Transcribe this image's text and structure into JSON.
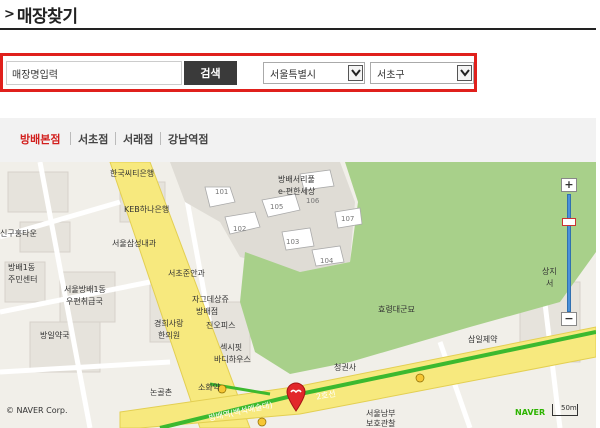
{
  "header": {
    "arrow": ">",
    "title": "매장찾기"
  },
  "search": {
    "input_value": "매장명입력",
    "button_label": "검색",
    "city_selected": "서울특별시",
    "district_selected": "서초구"
  },
  "tabs": [
    {
      "label": "방배본점",
      "active": true
    },
    {
      "label": "서초점",
      "active": false
    },
    {
      "label": "서래점",
      "active": false
    },
    {
      "label": "강남역점",
      "active": false
    }
  ],
  "map": {
    "labels": {
      "l01": "한국씨티은행",
      "l02": "KEB하나은행",
      "l03": "서울삼성내과",
      "l04": "서초준안과",
      "l05": "자그데상쥬",
      "l06": "방배점",
      "l07": "경희사랑",
      "l08": "한의원",
      "l09": "진오피스",
      "l10": "섹시핏",
      "l11": "바디하우스",
      "l12": "소화약",
      "l13": "논골촌",
      "l14": "신구홍타운",
      "l15": "방배1동",
      "l16": "주민센터",
      "l17": "서울방배1동",
      "l18": "우편취급국",
      "l19": "방일약국",
      "l20": "방배서리풀",
      "l21": "e-편한세상",
      "l22": "효령대군묘",
      "l23": "청권사",
      "l24": "삼일제약",
      "l25": "상지",
      "l26": "서",
      "l27": "서울남부",
      "l28": "보호관찰",
      "l29": "방배역(백석예술대)",
      "l30": "2호선",
      "b101": "101",
      "b102": "102",
      "b103": "103",
      "b104": "104",
      "b105": "105",
      "b106": "106",
      "b107": "107"
    },
    "zoom_in": "+",
    "zoom_out": "−",
    "copyright": "© NAVER Corp.",
    "logo": "NAVER",
    "scale_label": "50m"
  },
  "colors": {
    "accent_red": "#d2201e",
    "search_border": "#e0201c",
    "park_green": "#a8d08a",
    "road_yellow": "#f7e97e",
    "subway_green": "#3cb92f"
  }
}
